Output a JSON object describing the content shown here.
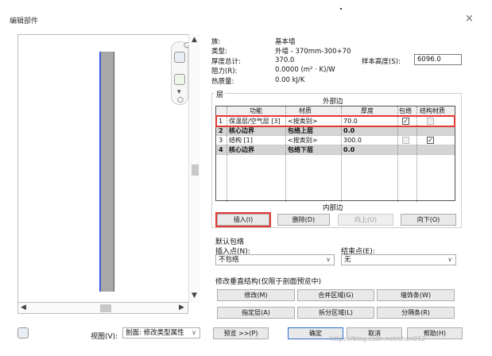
{
  "window": {
    "title": "编辑部件",
    "close_label": "×"
  },
  "info": {
    "family_label": "族:",
    "family_value": "基本墙",
    "type_label": "类型:",
    "type_value": "外墙 - 370mm-300+70",
    "thickness_label": "厚度总计:",
    "thickness_value": "370.0",
    "resistance_label": "阻力(R):",
    "resistance_value": "0.0000 (m² · K)/W",
    "mass_label": "热质量:",
    "mass_value": "0.00 kJ/K",
    "sample_height_label": "样本高度(S):",
    "sample_height_value": "6096.0"
  },
  "layers": {
    "group_label": "层",
    "exterior_label": "外部边",
    "interior_label": "内部边",
    "columns": [
      "功能",
      "材质",
      "厚度",
      "包络",
      "结构材质"
    ],
    "rows": [
      {
        "num": "1",
        "func": "保温层/空气层 [3]",
        "material": "<按类别>",
        "thickness": "70.0",
        "wrap": true,
        "struct": false,
        "core": false,
        "selected": true
      },
      {
        "num": "2",
        "func": "核心边界",
        "material": "包络上层",
        "thickness": "0.0",
        "core": true
      },
      {
        "num": "3",
        "func": "结构 [1]",
        "material": "<按类别>",
        "thickness": "300.0",
        "wrap": false,
        "struct": true,
        "core": false
      },
      {
        "num": "4",
        "func": "核心边界",
        "material": "包络下层",
        "thickness": "0.0",
        "core": true
      }
    ],
    "insert_label": "插入(I)",
    "delete_label": "删除(D)",
    "up_label": "向上(U)",
    "down_label": "向下(O)"
  },
  "wrapping": {
    "group_label": "默认包络",
    "insert_point_label": "插入点(N):",
    "insert_point_value": "不包络",
    "end_point_label": "结束点(E):",
    "end_point_value": "无"
  },
  "vertical": {
    "group_label": "修改垂直结构(仅限于剖面预览中)",
    "modify_label": "修改(M)",
    "merge_label": "合并区域(G)",
    "sweep_label": "墙饰条(W)",
    "assign_label": "指定层(A)",
    "split_label": "拆分区域(L)",
    "reveal_label": "分隔条(R)"
  },
  "footer": {
    "view_label": "视图(V):",
    "view_value": "剖面: 修改类型属性",
    "preview_label": "预览 >>(P)",
    "ok_label": "确定",
    "cancel_label": "取消",
    "help_label": "帮助(H)"
  },
  "watermark": "https://blog.csdn.net/chen012"
}
